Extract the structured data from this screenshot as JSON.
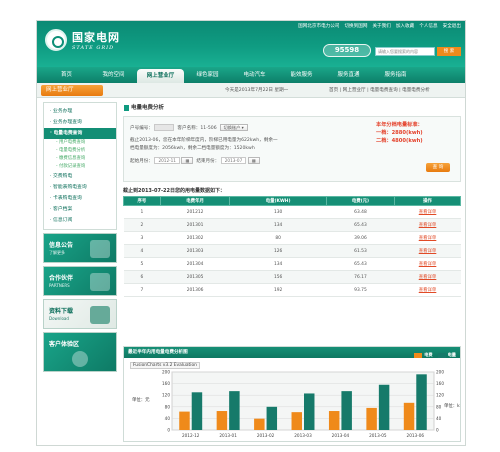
{
  "header": {
    "brand_cn": "国家电网",
    "brand_en": "STATE GRID",
    "top_links": [
      "国网北京市电力公司",
      "切换到国网",
      "关于我们",
      "加入收藏",
      "个人信息",
      "安全退出"
    ],
    "hotline": "95598",
    "search_placeholder": "请输入您要搜索的内容",
    "search_label": "搜 索"
  },
  "nav": {
    "items": [
      "首页",
      "我的空间",
      "网上营业厅",
      "绿色家园",
      "电动汽车",
      "能效服务",
      "服务直通",
      "服务指南"
    ],
    "active_index": 2
  },
  "crumb": {
    "hall": "网上营业厅",
    "date_text": "今天是2013年7月22日 星期一",
    "path": "首页 | 网上营业厅 | 电量电费查询 | 电量电费分析"
  },
  "sidebar": {
    "items": [
      {
        "label": "· 业务办理",
        "kind": "item"
      },
      {
        "label": "· 业务办理查询",
        "kind": "item"
      },
      {
        "label": "· 电量电费查询",
        "kind": "selected"
      },
      {
        "label": "- 用户电费查询",
        "kind": "sub"
      },
      {
        "label": "- 电量电费分析",
        "kind": "sub"
      },
      {
        "label": "- 缴费信息查询",
        "kind": "sub"
      },
      {
        "label": "- 付款记录查询",
        "kind": "sub"
      },
      {
        "label": "· 交费购电",
        "kind": "item"
      },
      {
        "label": "· 智能表购电查询",
        "kind": "item"
      },
      {
        "label": "· 卡表购电查询",
        "kind": "item"
      },
      {
        "label": "· 客户档案",
        "kind": "item"
      },
      {
        "label": "· 信息订阅",
        "kind": "item"
      }
    ],
    "cards": [
      {
        "title": "信息公告",
        "sub": "了解更多"
      },
      {
        "title": "合作伙伴",
        "sub": "PARTNERS"
      },
      {
        "title": "资料下载",
        "sub": "Download"
      },
      {
        "title": "客户体验区",
        "sub": ""
      }
    ]
  },
  "panel": {
    "title": "电量电费分析",
    "account_label": "户号编号：",
    "account_value": "",
    "name_label": "客户名称：11-506",
    "switch_label": "切换账户",
    "desc_line1": "截止2013-06，您在本年阶梯年度内，阶梯已用电量为622kwh，剩余一",
    "desc_line2": "档电量额度为：2056kwh，剩余二档电量额度为：1520kwh",
    "start_label": "起始月份：",
    "start_value": "2012-11",
    "end_label": "结束月份：",
    "end_value": "2013-07",
    "standard_title": "本年分档电量标准：",
    "standard_1": "一档：2880(kwh)",
    "standard_2": "二档：4800(kwh)",
    "query_label": "查 询",
    "as_of_title": "截止到2013-07-22日您的用电量数据如下："
  },
  "table": {
    "headers": [
      "序号",
      "电费年月",
      "电量(KWH)",
      "电费(元)",
      "操作"
    ],
    "rows": [
      [
        "1",
        "201212",
        "130",
        "63.48",
        "查看详单"
      ],
      [
        "2",
        "201301",
        "134",
        "65.43",
        "查看详单"
      ],
      [
        "3",
        "201302",
        "80",
        "39.06",
        "查看详单"
      ],
      [
        "4",
        "201303",
        "126",
        "61.53",
        "查看详单"
      ],
      [
        "5",
        "201304",
        "134",
        "65.43",
        "查看详单"
      ],
      [
        "6",
        "201305",
        "156",
        "76.17",
        "查看详单"
      ],
      [
        "7",
        "201306",
        "192",
        "93.75",
        "查看详单"
      ]
    ]
  },
  "chart_panel": {
    "title": "最近半年内用电量电费分析图",
    "fc_label": "FusionCharts v3.2 Evaluation",
    "y_unit_left": "单位：元",
    "y_unit_right": "单位：kwh",
    "colors": {
      "fee": "#ef8a1a",
      "power": "#167a6a"
    }
  },
  "chart_data": {
    "type": "bar",
    "categories": [
      "2012-12",
      "2013-01",
      "2013-02",
      "2013-03",
      "2013-04",
      "2013-05",
      "2013-06"
    ],
    "series": [
      {
        "name": "电费",
        "values": [
          63.48,
          65.43,
          39.06,
          61.53,
          65.43,
          76.17,
          93.75
        ]
      },
      {
        "name": "电量",
        "values": [
          130,
          134,
          80,
          126,
          134,
          156,
          192
        ]
      }
    ],
    "ylim": [
      0,
      200
    ],
    "yticks": [
      0,
      40,
      80,
      120,
      160,
      200
    ],
    "grid": true,
    "legend": "top-right"
  }
}
